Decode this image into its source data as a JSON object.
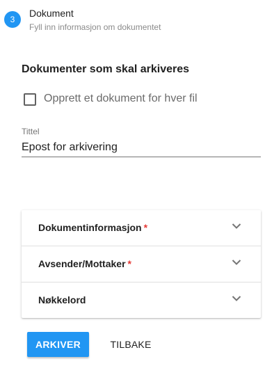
{
  "step": {
    "number": "3",
    "title": "Dokument",
    "subtitle": "Fyll inn informasjon om dokumentet"
  },
  "section": {
    "heading": "Dokumenter som skal arkiveres"
  },
  "checkbox": {
    "label": "Opprett et dokument for hver fil",
    "checked": false
  },
  "title_field": {
    "label": "Tittel",
    "value": "Epost for arkivering"
  },
  "accordion": {
    "items": [
      {
        "label": "Dokumentinformasjon",
        "required_mark": "*"
      },
      {
        "label": "Avsender/Mottaker",
        "required_mark": "*"
      },
      {
        "label": "Nøkkelord",
        "required_mark": ""
      }
    ]
  },
  "actions": {
    "primary_label": "ARKIVER",
    "secondary_label": "TILBAKE"
  },
  "colors": {
    "primary": "#2196f3",
    "required": "#e53935"
  }
}
